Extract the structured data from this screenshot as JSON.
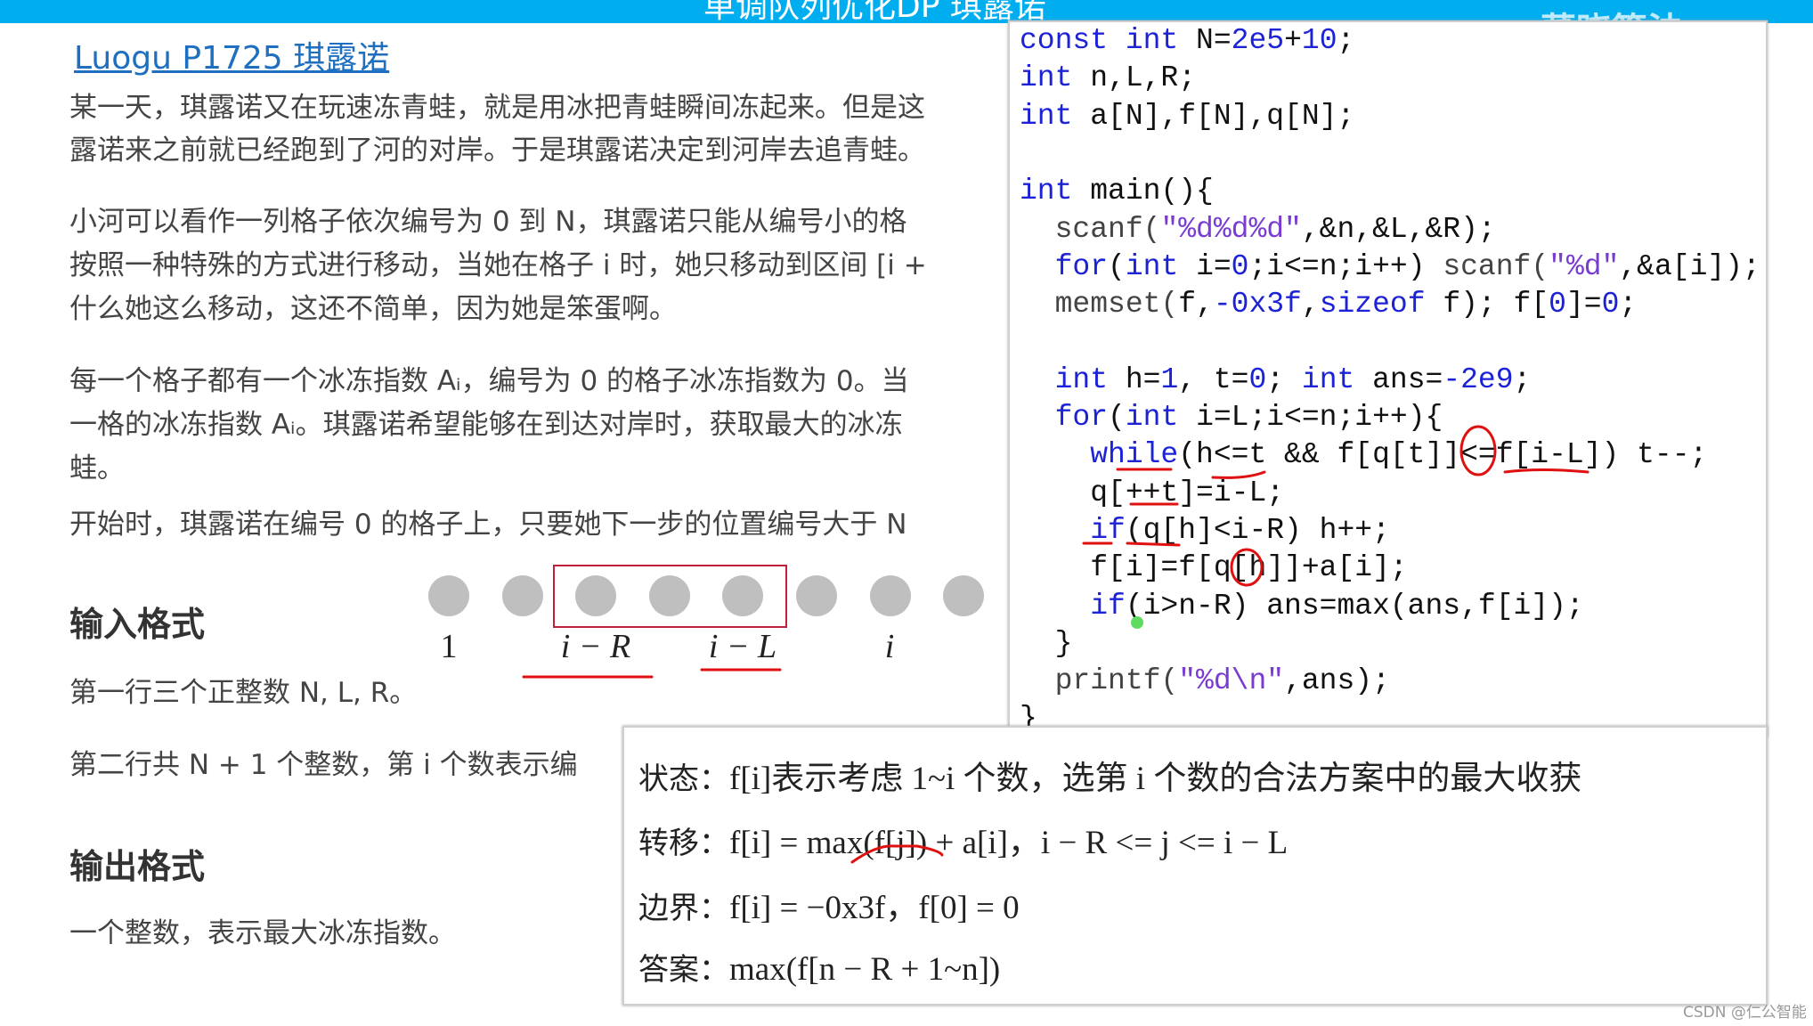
{
  "header": {
    "title": "单调队列优化DP 琪露诺",
    "watermark": "董晓算法",
    "bar_color": "#00aeef"
  },
  "problem": {
    "link": "Luogu P1725 琪露诺",
    "paragraphs": [
      "某一天，琪露诺又在玩速冻青蛙，就是用冰把青蛙瞬间冻起来。但是这",
      "露诺来之前就已经跑到了河的对岸。于是琪露诺决定到河岸去追青蛙。",
      "小河可以看作一列格子依次编号为 0 到 N，琪露诺只能从编号小的格",
      "按照一种特殊的方式进行移动，当她在格子 i 时，她只移动到区间 [i +",
      "什么她这么移动，这还不简单，因为她是笨蛋啊。",
      "每一个格子都有一个冰冻指数 Aᵢ，编号为 0 的格子冰冻指数为 0。当",
      "一格的冰冻指数 Aᵢ。琪露诺希望能够在到达对岸时，获取最大的冰冻",
      "蛙。",
      "开始时，琪露诺在编号 0 的格子上，只要她下一步的位置编号大于 N"
    ],
    "input_heading": "输入格式",
    "input_lines": [
      "第一行三个正整数 N, L, R。",
      "第二行共 N + 1 个整数，第 i 个数表示编"
    ],
    "output_heading": "输出格式",
    "output_lines": [
      "一个整数，表示最大冰冻指数。"
    ]
  },
  "diagram": {
    "dot_count": 8,
    "labels": [
      "1",
      "i − R",
      "i − L",
      "i"
    ],
    "highlight_color": "#c0203a"
  },
  "code": [
    [
      [
        "const int ",
        "kw"
      ],
      [
        "N=",
        "t"
      ],
      [
        "2e5",
        "num"
      ],
      [
        "+",
        "t"
      ],
      [
        "10",
        "num"
      ],
      [
        ";",
        "t"
      ]
    ],
    [
      [
        "int ",
        "kw"
      ],
      [
        "n,L,R;",
        "t"
      ]
    ],
    [
      [
        "int ",
        "kw"
      ],
      [
        "a[N],f[N],q[N];",
        "t"
      ]
    ],
    [],
    [
      [
        "int ",
        "kw"
      ],
      [
        "main(){",
        "t"
      ]
    ],
    [
      [
        "  scanf(",
        "fn"
      ],
      [
        "\"%d%d%d\"",
        "str"
      ],
      [
        ",&n,&L,&R);",
        "t"
      ]
    ],
    [
      [
        "  for",
        "kw"
      ],
      [
        "(",
        "t"
      ],
      [
        "int ",
        "kw"
      ],
      [
        "i=",
        "t"
      ],
      [
        "0",
        "num"
      ],
      [
        ";i<=n;i++) ",
        "t"
      ],
      [
        "scanf(",
        "fn"
      ],
      [
        "\"%d\"",
        "str"
      ],
      [
        ",&a[i]);",
        "t"
      ]
    ],
    [
      [
        "  memset(",
        "fn"
      ],
      [
        "f,",
        "t"
      ],
      [
        "-0x3f",
        "num"
      ],
      [
        ",",
        "t"
      ],
      [
        "sizeof ",
        "kw"
      ],
      [
        "f); f[",
        "t"
      ],
      [
        "0",
        "num"
      ],
      [
        "]=",
        "t"
      ],
      [
        "0",
        "num"
      ],
      [
        ";",
        "t"
      ]
    ],
    [],
    [
      [
        "  int ",
        "kw"
      ],
      [
        "h=",
        "t"
      ],
      [
        "1",
        "num"
      ],
      [
        ", t=",
        "t"
      ],
      [
        "0",
        "num"
      ],
      [
        "; ",
        "t"
      ],
      [
        "int ",
        "kw"
      ],
      [
        "ans=",
        "t"
      ],
      [
        "-2e9",
        "num"
      ],
      [
        ";",
        "t"
      ]
    ],
    [
      [
        "  for",
        "kw"
      ],
      [
        "(",
        "t"
      ],
      [
        "int ",
        "kw"
      ],
      [
        "i=L;i<=n;i++){",
        "t"
      ]
    ],
    [
      [
        "    while",
        "kw"
      ],
      [
        "(h<=t && f[q[t]]<=f[i-L]) t--;",
        "t"
      ]
    ],
    [
      [
        "    q[++t]=i-L;",
        "t"
      ]
    ],
    [
      [
        "    if",
        "kw"
      ],
      [
        "(q[h]<i-R) h++;",
        "t"
      ]
    ],
    [
      [
        "    f[i]=f[q[h]]+a[i];",
        "t"
      ]
    ],
    [
      [
        "    if",
        "kw"
      ],
      [
        "(i>n-R) ans=max(ans,f[i]);",
        "t"
      ]
    ],
    [
      [
        "  }",
        "t"
      ]
    ],
    [
      [
        "  printf(",
        "fn"
      ],
      [
        "\"%d\\n\"",
        "str"
      ],
      [
        ",ans);",
        "t"
      ]
    ],
    [
      [
        "}",
        "t"
      ]
    ]
  ],
  "summary": {
    "state": {
      "label": "状态：",
      "text": "f[i]表示考虑 1~i 个数，选第 i 个数的合法方案中的最大收获"
    },
    "transition": {
      "label": "转移：",
      "text": "f[i] = max(f[j]) + a[i]，i − R <= j <= i − L"
    },
    "boundary": {
      "label": "边界：",
      "text": "f[i] = −0x3f，f[0] = 0"
    },
    "answer": {
      "label": "答案：",
      "text": "max(f[n − R + 1~n])"
    }
  },
  "footer": "CSDN @仁公智能"
}
